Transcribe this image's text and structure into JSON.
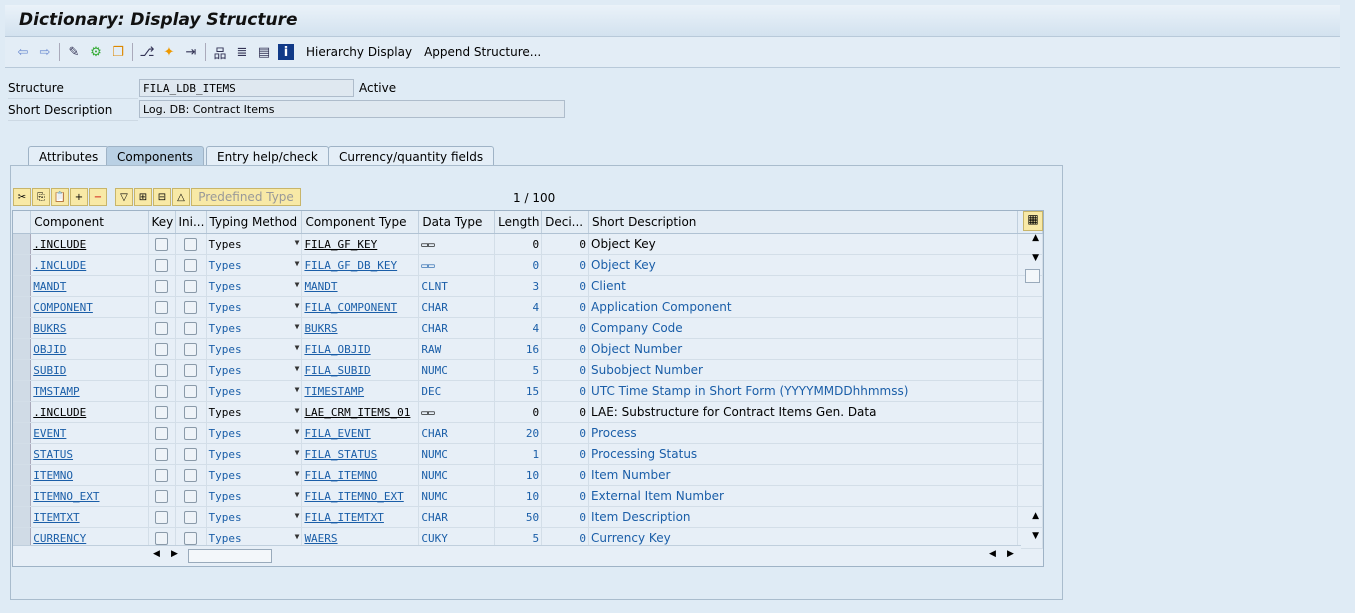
{
  "title": "Dictionary: Display Structure",
  "toolbar": {
    "hierarchy_display": "Hierarchy Display",
    "append_structure": "Append Structure..."
  },
  "fields": {
    "structure_label": "Structure",
    "structure_value": "FILA_LDB_ITEMS",
    "status": "Active",
    "short_desc_label": "Short Description",
    "short_desc_value": "Log. DB: Contract Items"
  },
  "tabs": [
    {
      "label": "Attributes"
    },
    {
      "label": "Components",
      "active": true
    },
    {
      "label": "Entry help/check"
    },
    {
      "label": "Currency/quantity fields"
    }
  ],
  "grid_toolbar": {
    "predefined_type": "Predefined Type",
    "page": "1",
    "total": "100"
  },
  "columns": [
    "Component",
    "Key",
    "Ini...",
    "Typing Method",
    "Component Type",
    "Data Type",
    "Length",
    "Deci...",
    "Short Description"
  ],
  "rows": [
    {
      "c": ".INCLUDE",
      "t": "Types",
      "ct": "FILA_GF_KEY",
      "dt": "▭▭",
      "l": "0",
      "d": "0",
      "s": "Object Key",
      "dark": true
    },
    {
      "c": ".INCLUDE",
      "t": "Types",
      "ct": "FILA_GF_DB_KEY",
      "dt": "▭▭",
      "l": "0",
      "d": "0",
      "s": "Object Key"
    },
    {
      "c": "MANDT",
      "t": "Types",
      "ct": "MANDT",
      "dt": "CLNT",
      "l": "3",
      "d": "0",
      "s": "Client"
    },
    {
      "c": "COMPONENT",
      "t": "Types",
      "ct": "FILA_COMPONENT",
      "dt": "CHAR",
      "l": "4",
      "d": "0",
      "s": "Application Component"
    },
    {
      "c": "BUKRS",
      "t": "Types",
      "ct": "BUKRS",
      "dt": "CHAR",
      "l": "4",
      "d": "0",
      "s": "Company Code"
    },
    {
      "c": "OBJID",
      "t": "Types",
      "ct": "FILA_OBJID",
      "dt": "RAW",
      "l": "16",
      "d": "0",
      "s": "Object Number"
    },
    {
      "c": "SUBID",
      "t": "Types",
      "ct": "FILA_SUBID",
      "dt": "NUMC",
      "l": "5",
      "d": "0",
      "s": "Subobject Number"
    },
    {
      "c": "TMSTAMP",
      "t": "Types",
      "ct": "TIMESTAMP",
      "dt": "DEC",
      "l": "15",
      "d": "0",
      "s": "UTC Time Stamp in Short Form (YYYYMMDDhhmmss)"
    },
    {
      "c": ".INCLUDE",
      "t": "Types",
      "ct": "LAE_CRM_ITEMS_01",
      "dt": "▭▭",
      "l": "0",
      "d": "0",
      "s": "LAE:  Substructure for Contract Items Gen. Data",
      "dark": true
    },
    {
      "c": "EVENT",
      "t": "Types",
      "ct": "FILA_EVENT",
      "dt": "CHAR",
      "l": "20",
      "d": "0",
      "s": "Process"
    },
    {
      "c": "STATUS",
      "t": "Types",
      "ct": "FILA_STATUS",
      "dt": "NUMC",
      "l": "1",
      "d": "0",
      "s": "Processing Status"
    },
    {
      "c": "ITEMNO",
      "t": "Types",
      "ct": "FILA_ITEMNO",
      "dt": "NUMC",
      "l": "10",
      "d": "0",
      "s": "Item Number"
    },
    {
      "c": "ITEMNO_EXT",
      "t": "Types",
      "ct": "FILA_ITEMNO_EXT",
      "dt": "NUMC",
      "l": "10",
      "d": "0",
      "s": "External Item Number"
    },
    {
      "c": "ITEMTXT",
      "t": "Types",
      "ct": "FILA_ITEMTXT",
      "dt": "CHAR",
      "l": "50",
      "d": "0",
      "s": "Item Description"
    },
    {
      "c": "CURRENCY",
      "t": "Types",
      "ct": "WAERS",
      "dt": "CUKY",
      "l": "5",
      "d": "0",
      "s": "Currency Key"
    }
  ]
}
